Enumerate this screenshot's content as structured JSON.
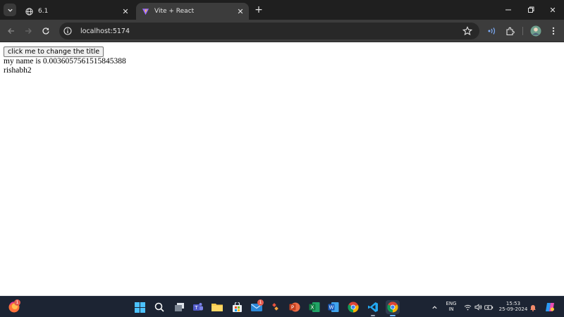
{
  "browser": {
    "tabs": [
      {
        "title": "6.1",
        "active": false
      },
      {
        "title": "Vite + React",
        "active": true
      }
    ],
    "new_tab_label": "+",
    "address": "localhost:5174"
  },
  "page": {
    "button_label": "click me to change the title",
    "line1": "my name is 0.0036057561515845388",
    "line2": "rishabh2"
  },
  "taskbar": {
    "badges": {
      "firefox": "1",
      "mail": "1"
    },
    "language": "ENG",
    "region": "IN",
    "time": "15:53",
    "date": "25-09-2024"
  },
  "colors": {
    "tabstrip": "#1f1f1f",
    "toolbar": "#3c3c3c",
    "taskbar": "#1c2433",
    "accent": "#7cacf8"
  }
}
